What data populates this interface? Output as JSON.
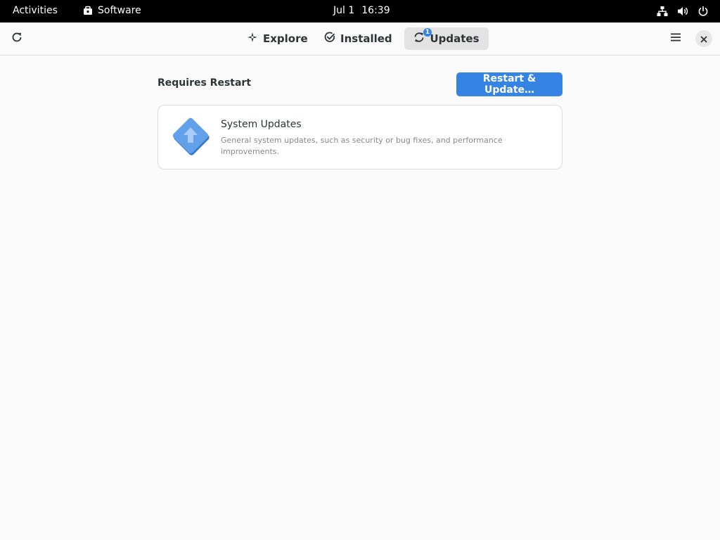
{
  "topbar": {
    "activities": "Activities",
    "app_name": "Software",
    "date": "Jul 1",
    "time": "16:39"
  },
  "header": {
    "tabs": [
      {
        "label": "Explore",
        "icon": "explore-icon"
      },
      {
        "label": "Installed",
        "icon": "installed-check-icon"
      },
      {
        "label": "Updates",
        "icon": "updates-icon",
        "badge": "1",
        "active": true
      }
    ]
  },
  "content": {
    "section_title": "Requires Restart",
    "restart_button": "Restart & Update…",
    "updates": [
      {
        "name": "System Updates",
        "description": "General system updates, such as security or bug fixes, and performance improvements.",
        "icon": "system-update-icon"
      }
    ]
  },
  "colors": {
    "accent": "#3584e4",
    "topbar_bg": "#000000",
    "window_bg": "#fafafa"
  }
}
